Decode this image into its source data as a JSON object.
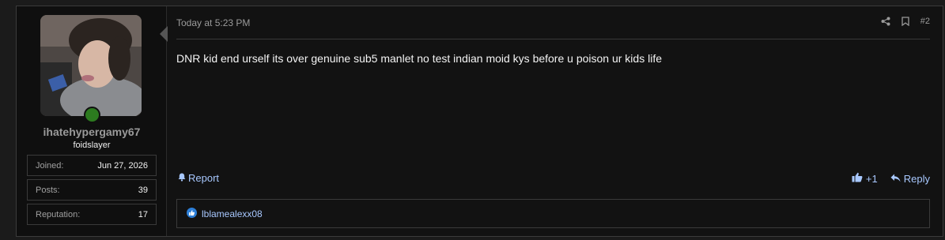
{
  "user": {
    "username": "ihatehypergamy67",
    "title": "foidslayer",
    "stats": [
      {
        "label": "Joined:",
        "value": "Jun 27, 2026"
      },
      {
        "label": "Posts:",
        "value": "39"
      },
      {
        "label": "Reputation:",
        "value": "17"
      }
    ]
  },
  "post": {
    "timestamp": "Today at 5:23 PM",
    "number": "#2",
    "content": "DNR kid end urself its over genuine sub5 manlet no test indian moid kys before u poison ur kids life",
    "report_label": "Report",
    "like_count": "+1",
    "reply_label": "Reply",
    "reactions_user": "lblamealexx08"
  },
  "colors": {
    "link": "#a8c8ff",
    "online": "#2c7a1f",
    "background": "#121212"
  }
}
